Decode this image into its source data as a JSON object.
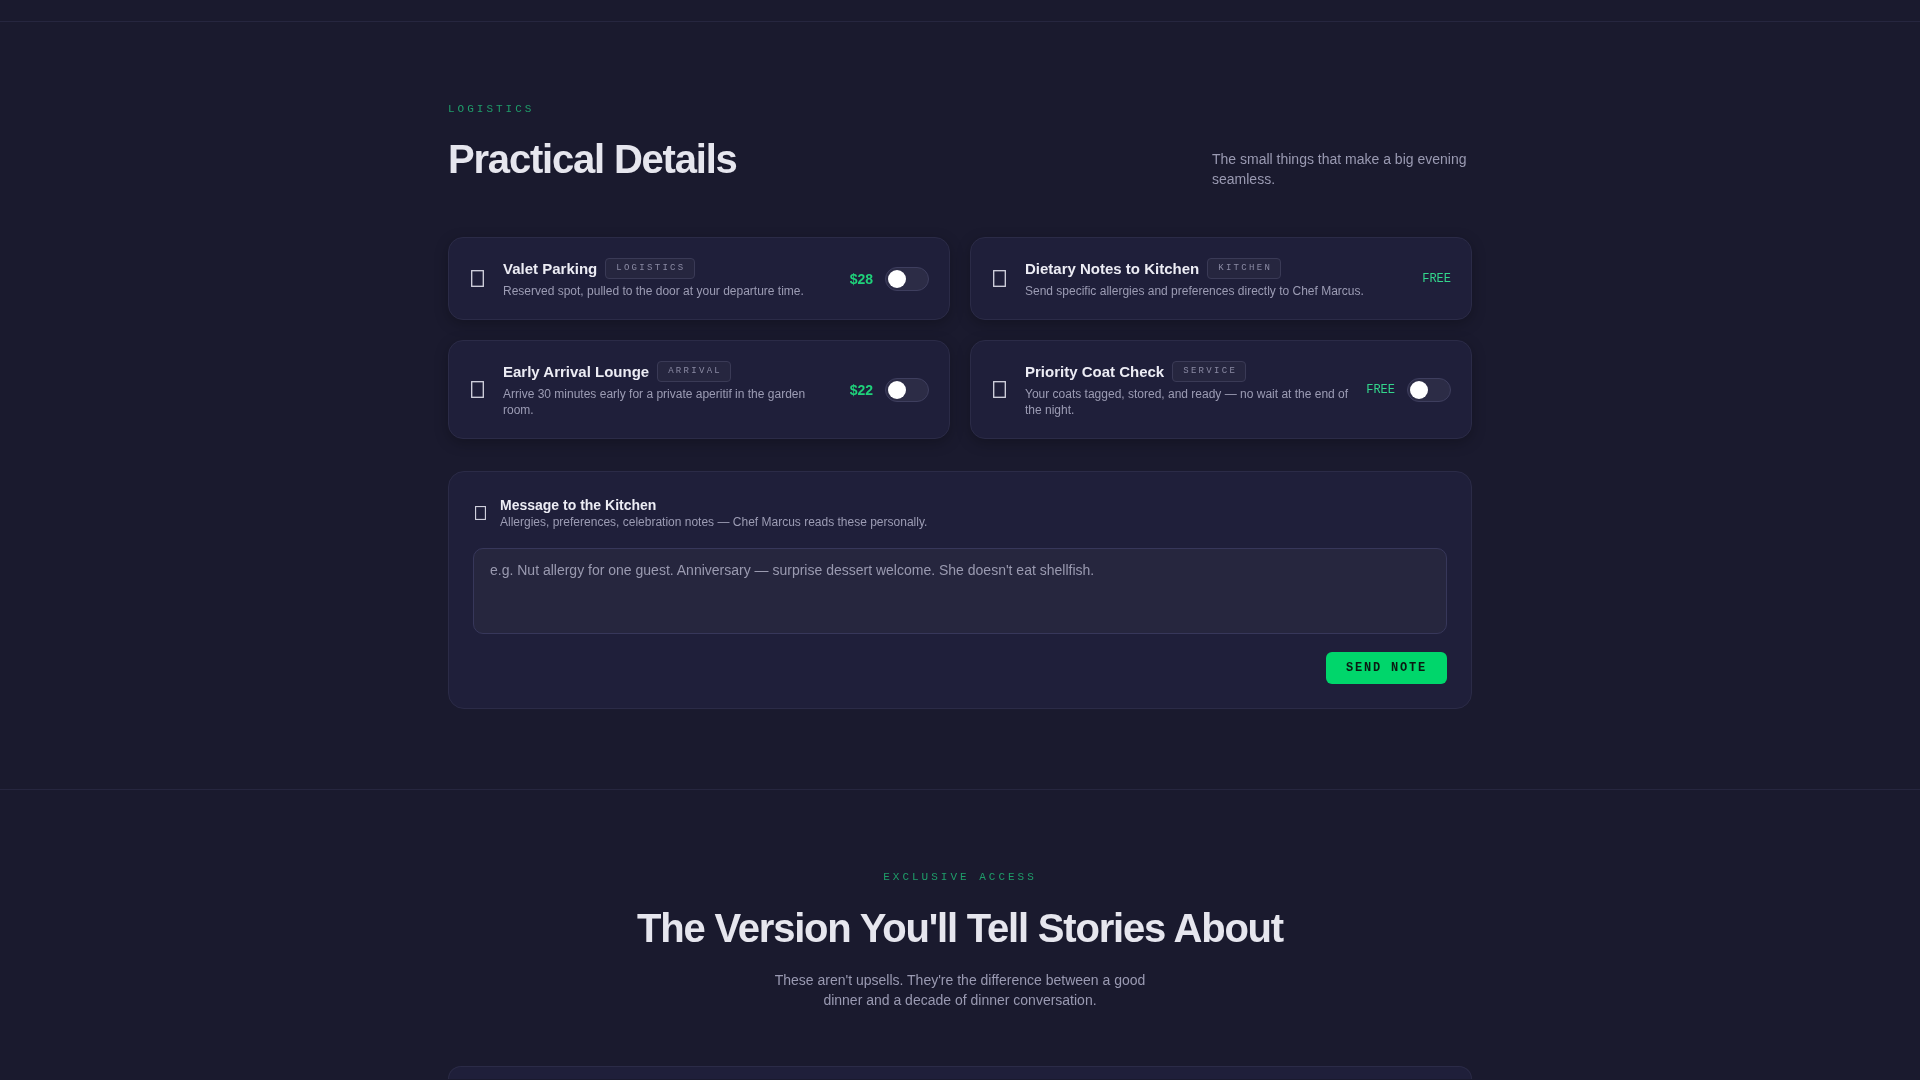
{
  "logistics": {
    "eyebrow": "LOGISTICS",
    "title": "Practical Details",
    "subtitle": "The small things that make a big evening seamless."
  },
  "options": [
    {
      "kind": "switch",
      "title": "Valet Parking",
      "tag": "LOGISTICS",
      "description": "Reserved spot, pulled to the door at your departure time.",
      "price": {
        "kind": "amount",
        "text": "$28"
      },
      "on": false
    },
    {
      "kind": "included",
      "title": "Dietary Notes to Kitchen",
      "tag": "KITCHEN",
      "description": "Send specific allergies and preferences directly to Chef Marcus.",
      "price": {
        "kind": "free",
        "text": "FREE"
      }
    },
    {
      "kind": "switch",
      "title": "Early Arrival Lounge",
      "tag": "ARRIVAL",
      "description": "Arrive 30 minutes early for a private aperitif in the garden room.",
      "price": {
        "kind": "amount",
        "text": "$22"
      },
      "on": false
    },
    {
      "kind": "switch",
      "title": "Priority Coat Check",
      "tag": "SERVICE",
      "description": "Your coats tagged, stored, and ready — no wait at the end of the night.",
      "price": {
        "kind": "free",
        "text": "FREE"
      },
      "on": false
    }
  ],
  "kitchen_message": {
    "title": "Message to the Kitchen",
    "subtitle": "Allergies, preferences, celebration notes — Chef Marcus reads these personally.",
    "placeholder": "e.g. Nut allergy for one guest. Anniversary — surprise dessert welcome. She doesn't eat shellfish.",
    "button": "SEND NOTE"
  },
  "exclusive": {
    "eyebrow": "EXCLUSIVE ACCESS",
    "title": "The Version You'll Tell Stories About",
    "subtitle": "These aren't upsells. They're the difference between a good dinner and a decade of dinner conversation."
  }
}
